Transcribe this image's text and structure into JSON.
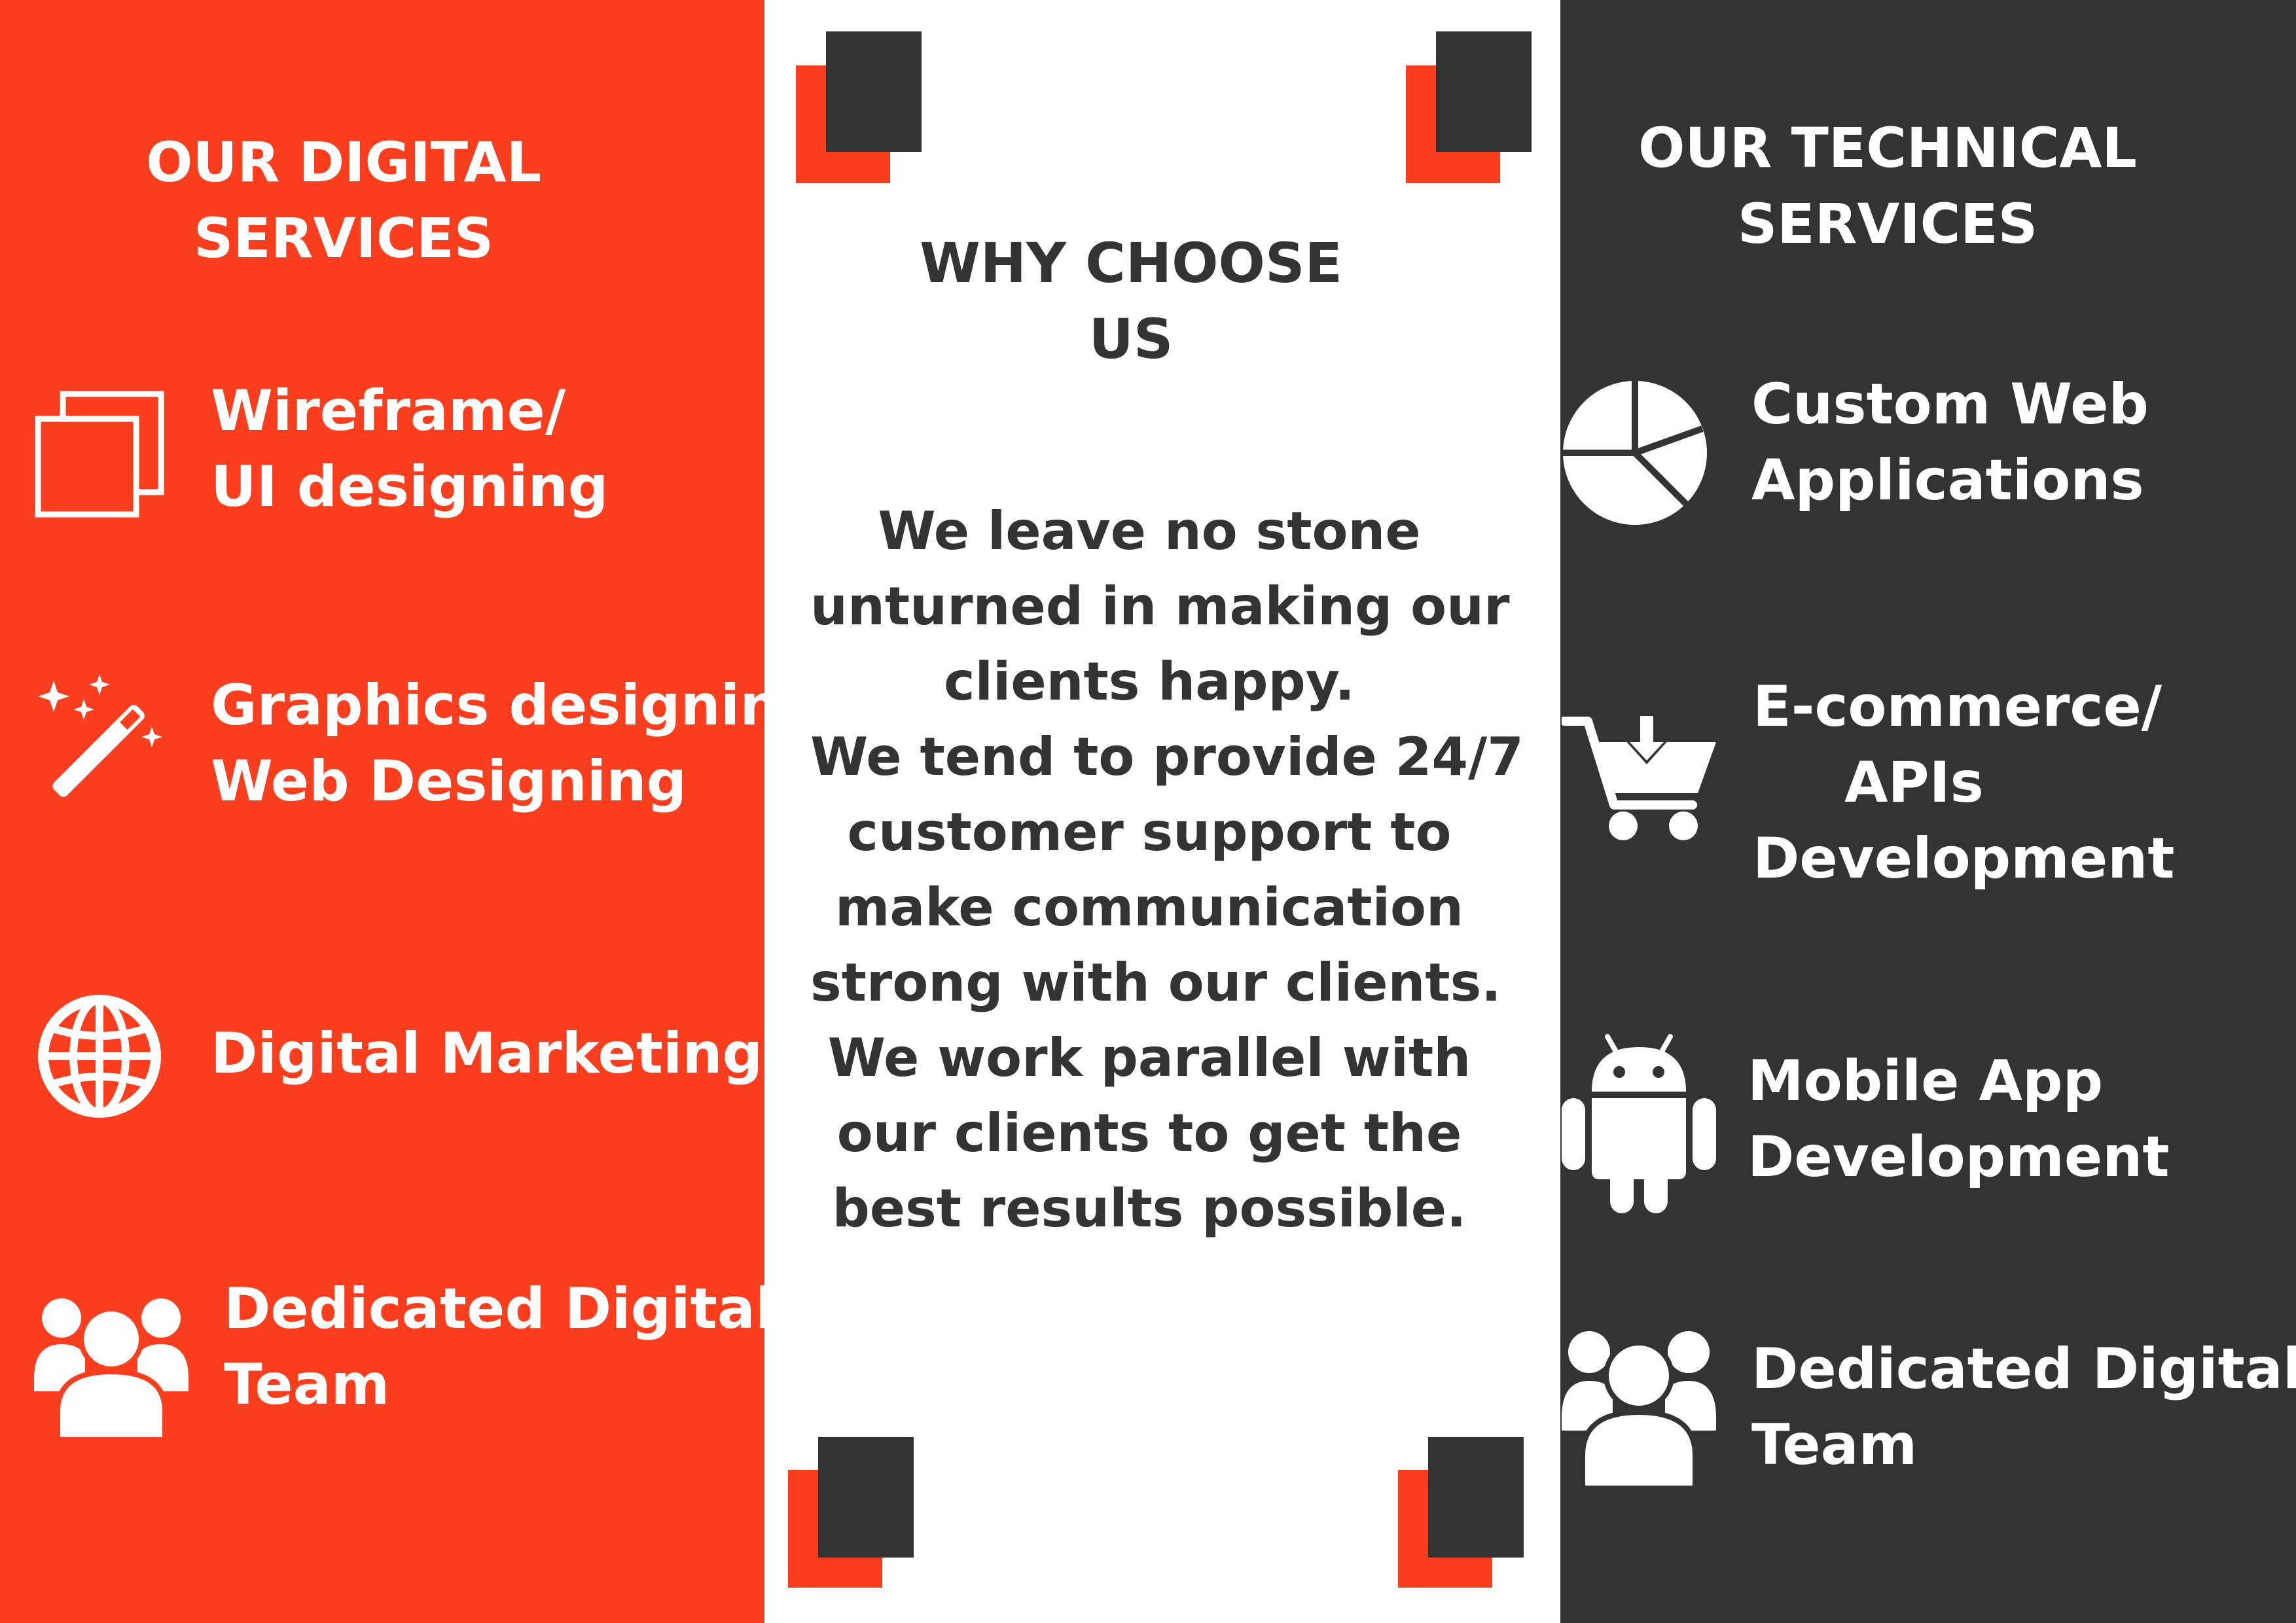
{
  "colors": {
    "orange": "#fb3e1d",
    "dark": "#333333",
    "white": "#ffffff"
  },
  "left": {
    "heading": [
      "OUR DIGITAL",
      "SERVICES"
    ],
    "items": [
      {
        "icon": "wireframe-icon",
        "lines": [
          "Wireframe/",
          "UI designing"
        ]
      },
      {
        "icon": "magic-wand-icon",
        "lines": [
          "Graphics designing",
          "Web Designing"
        ]
      },
      {
        "icon": "globe-icon",
        "lines": [
          "Digital Marketing"
        ]
      },
      {
        "icon": "team-icon",
        "lines": [
          "Dedicated Digital",
          "Team"
        ]
      }
    ]
  },
  "middle": {
    "heading": [
      "WHY CHOOSE",
      "US"
    ],
    "body": [
      "We leave no stone",
      "unturned in making our",
      "clients happy.",
      "We tend to provide 24/7",
      "customer support to",
      "make communication",
      "strong with our clients.",
      "We work parallel with",
      "our clients to get the",
      "best results possible."
    ]
  },
  "right": {
    "heading": [
      "OUR TECHNICAL",
      "SERVICES"
    ],
    "items": [
      {
        "icon": "pie-chart-icon",
        "lines": [
          "Custom Web",
          "Applications"
        ]
      },
      {
        "icon": "shopping-cart-download-icon",
        "lines": [
          "E-commerce/",
          "APIs",
          "Development"
        ]
      },
      {
        "icon": "android-icon",
        "lines": [
          "Mobile App",
          "Development"
        ]
      },
      {
        "icon": "team-icon",
        "lines": [
          "Dedicated Digital",
          "Team"
        ]
      }
    ]
  }
}
